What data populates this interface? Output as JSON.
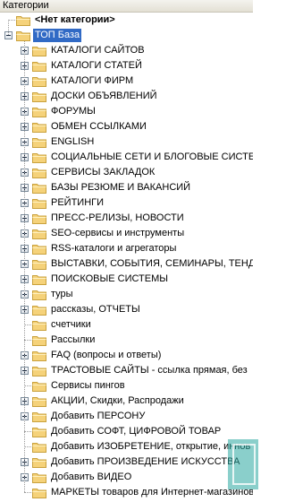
{
  "header": {
    "title": "Категории"
  },
  "tree": {
    "top_items": [
      {
        "label": "<Нет категории>",
        "bold": true
      },
      {
        "label": "ТОП База",
        "selected": true,
        "expanded": true
      }
    ],
    "children": [
      {
        "label": "КАТАЛОГИ САЙТОВ",
        "has_children": true
      },
      {
        "label": "КАТАЛОГИ СТАТЕЙ",
        "has_children": true
      },
      {
        "label": "КАТАЛОГИ ФИРМ",
        "has_children": true
      },
      {
        "label": "ДОСКИ ОБЪЯВЛЕНИЙ",
        "has_children": true
      },
      {
        "label": "ФОРУМЫ",
        "has_children": true
      },
      {
        "label": "ОБМЕН ССЫЛКАМИ",
        "has_children": true
      },
      {
        "label": "ENGLISH",
        "has_children": true
      },
      {
        "label": "СОЦИАЛЬНЫЕ СЕТИ И БЛОГОВЫЕ СИСТЕ",
        "has_children": true
      },
      {
        "label": "СЕРВИСЫ ЗАКЛАДОК",
        "has_children": true
      },
      {
        "label": "БАЗЫ РЕЗЮМЕ И ВАКАНСИЙ",
        "has_children": true
      },
      {
        "label": "РЕЙТИНГИ",
        "has_children": true
      },
      {
        "label": "ПРЕСС-РЕЛИЗЫ, НОВОСТИ",
        "has_children": true
      },
      {
        "label": "SEO-сервисы и инструменты",
        "has_children": true
      },
      {
        "label": "RSS-каталоги и агрегаторы",
        "has_children": true
      },
      {
        "label": "ВЫСТАВКИ, СОБЫТИЯ, СЕМИНАРЫ, ТЕНД",
        "has_children": true
      },
      {
        "label": "ПОИСКОВЫЕ СИСТЕМЫ",
        "has_children": true
      },
      {
        "label": "туры",
        "has_children": true
      },
      {
        "label": "рассказы, ОТЧЕТЫ",
        "has_children": true
      },
      {
        "label": "счетчики",
        "has_children": false
      },
      {
        "label": "Рассылки",
        "has_children": false
      },
      {
        "label": "FAQ (вопросы и ответы)",
        "has_children": true
      },
      {
        "label": "ТРАСТОВЫЕ САЙТЫ - ссылка прямая, без",
        "has_children": true
      },
      {
        "label": "Сервисы пингов",
        "has_children": false
      },
      {
        "label": "АКЦИИ, Скидки, Распродажи",
        "has_children": true
      },
      {
        "label": "Добавить ПЕРСОНУ",
        "has_children": true
      },
      {
        "label": "Добавить СОФТ, ЦИФРОВОЙ ТОВАР",
        "has_children": false
      },
      {
        "label": "Добавить ИЗОБРЕТЕНИЕ, открытие, иннов",
        "has_children": false
      },
      {
        "label": "Добавить ПРОИЗВЕДЕНИЕ ИСКУССТВА",
        "has_children": true
      },
      {
        "label": "Добавить ВИДЕО",
        "has_children": true
      },
      {
        "label": "МАРКЕТЫ товаров для Интернет-магазинов",
        "has_children": false
      }
    ]
  },
  "icons": {
    "folder": "folder-icon",
    "expand": "plus-icon",
    "collapse": "minus-icon"
  },
  "colors": {
    "selection": "#316ac5",
    "folder_fill": "#f5d27a",
    "folder_edge": "#c9a13c",
    "tree_line": "#9a9a9a",
    "watermark": "#2aa7a0"
  }
}
